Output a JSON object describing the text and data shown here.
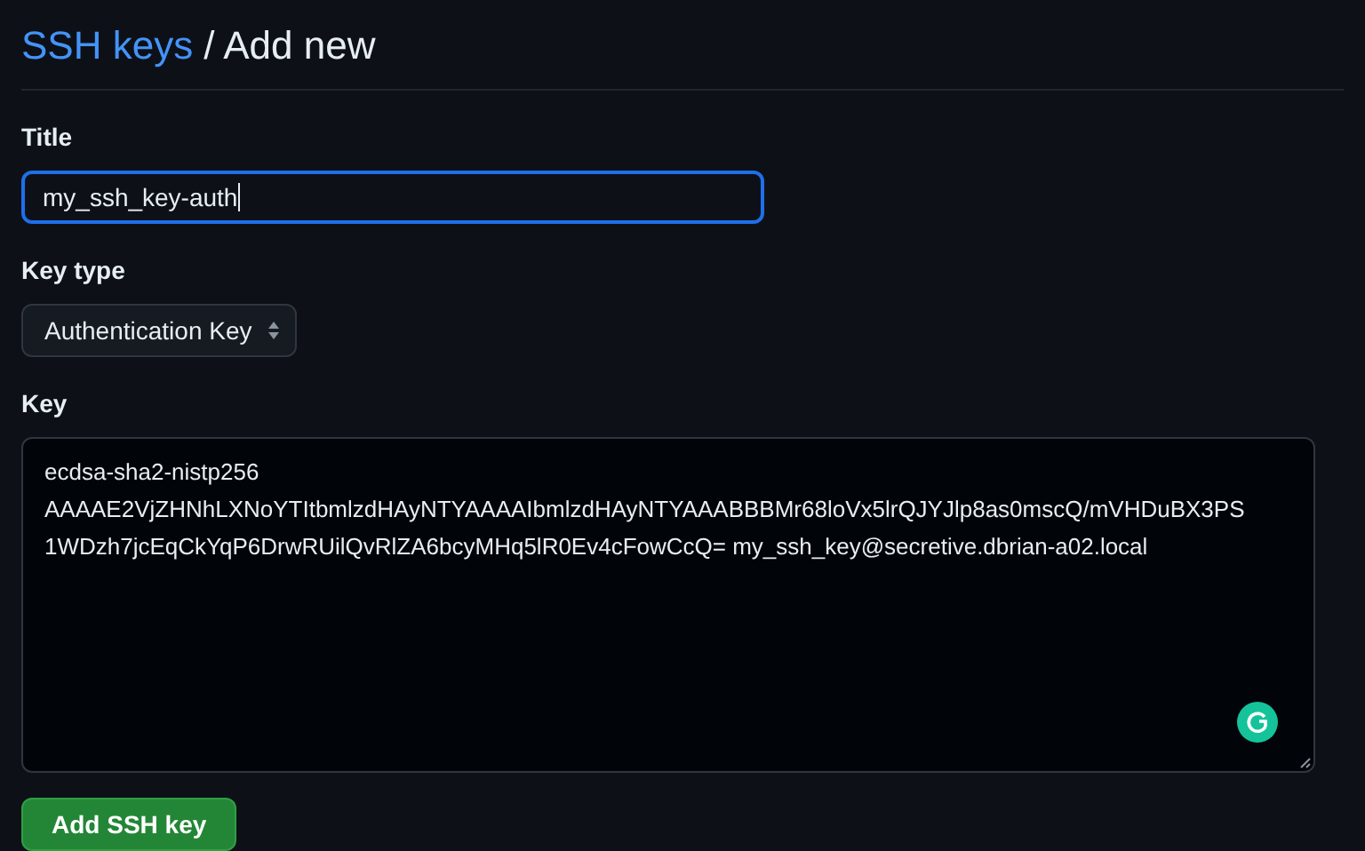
{
  "heading": {
    "link": "SSH keys",
    "rest": "/ Add new"
  },
  "title_field": {
    "label": "Title",
    "value": "my_ssh_key-auth"
  },
  "key_type": {
    "label": "Key type",
    "value": "Authentication Key"
  },
  "key_field": {
    "label": "Key",
    "lines": [
      "ecdsa-sha2-nistp256",
      "AAAAE2VjZHNhLXNoYTItbmlzdHAyNTYAAAAIbmlzdHAyNTYAAABBBMr68loVx5lrQJYJlp8as0mscQ/mVHDuBX3PS",
      "1WDzh7jcEqCkYqP6DrwRUilQvRlZA6bcyMHq5lR0Ev4cFowCcQ= my_ssh_key@secretive.dbrian-a02.local"
    ]
  },
  "submit": "Add SSH key"
}
